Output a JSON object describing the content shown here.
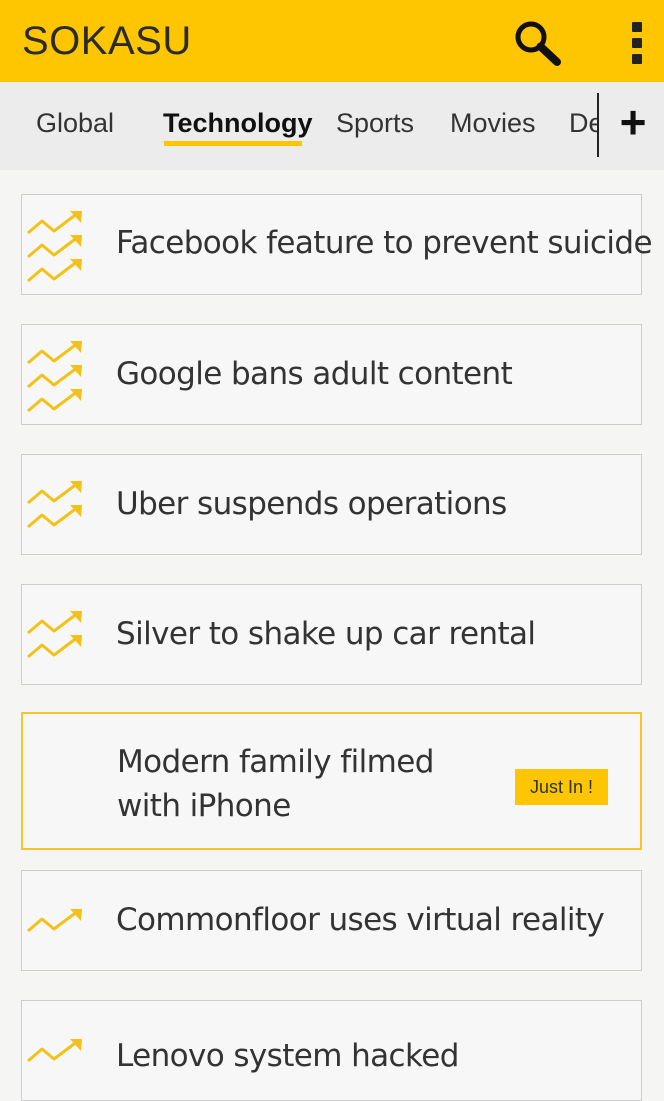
{
  "app": {
    "title": "SOKASU"
  },
  "colors": {
    "accent": "#fec600",
    "text": "#333333",
    "card_border": "#cdcdcd",
    "highlight_border": "#f7c52a"
  },
  "icons": {
    "search": "search-icon",
    "menu": "more-vertical-icon",
    "trend": "trending-up-icon",
    "add": "plus-icon"
  },
  "tabs": [
    {
      "label": "Global",
      "active": false
    },
    {
      "label": "Technology",
      "active": true
    },
    {
      "label": "Sports",
      "active": false
    },
    {
      "label": "Movies",
      "active": false
    },
    {
      "label": "De",
      "active": false
    }
  ],
  "add_tab_label": "+",
  "stories": [
    {
      "headline": "Facebook feature to prevent suicide",
      "trend_level": 3
    },
    {
      "headline": "Google bans adult content",
      "trend_level": 3
    },
    {
      "headline": "Uber suspends operations",
      "trend_level": 2
    },
    {
      "headline": "Silver to shake up car rental",
      "trend_level": 2
    },
    {
      "headline_line1": "Modern family filmed",
      "headline_line2": "with iPhone",
      "badge": "Just In !",
      "trend_level": 0
    },
    {
      "headline": "Commonfloor uses virtual reality",
      "trend_level": 1
    },
    {
      "headline": "Lenovo system hacked",
      "trend_level": 1
    }
  ]
}
